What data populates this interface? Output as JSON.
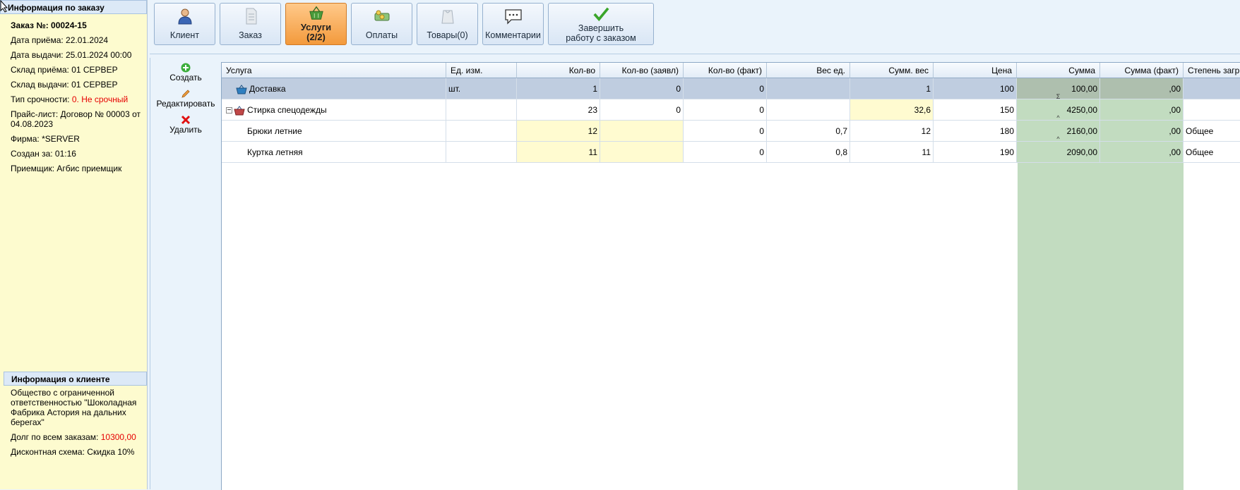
{
  "order_panel": {
    "title": "Информация по заказу",
    "order_number": "Заказ №: 00024-15",
    "received_date": "Дата приёма: 22.01.2024",
    "issue_date": "Дата выдачи: 25.01.2024 00:00",
    "receive_warehouse": "Склад приёма: 01 СЕРВЕР",
    "issue_warehouse": "Склад выдачи: 01 СЕРВЕР",
    "urgency_label": "Тип срочности:",
    "urgency_value": "0. Не срочный",
    "price_list": "Прайс-лист: Договор № 00003 от 04.08.2023",
    "firm": "Фирма: *SERVER",
    "created_for": "Создан за: 01:16",
    "receiver": "Приемщик: Агбис приемщик"
  },
  "client_panel": {
    "title": "Информация о клиенте",
    "name": "Общество с ограниченной ответственностью \"Шоколадная Фабрика Астория на дальних берегах\"",
    "debt_label": "Долг по всем заказам:",
    "debt_value": "10300,00",
    "discount": "Дисконтная схема: Скидка 10%"
  },
  "toolbar": {
    "client": "Клиент",
    "order": "Заказ",
    "services_line1": "Услуги",
    "services_line2": "(2/2)",
    "payments": "Оплаты",
    "goods": "Товары(0)",
    "comments": "Комментарии",
    "finish_line1": "Завершить",
    "finish_line2": "работу с заказом"
  },
  "actions": {
    "create": "Создать",
    "edit": "Редактировать",
    "delete": "Удалить"
  },
  "grid": {
    "columns": [
      "Услуга",
      "Ед. изм.",
      "Кол-во",
      "Кол-во (заявл)",
      "Кол-во (факт)",
      "Вес ед.",
      "Сумм. вес",
      "Цена",
      "Сумма",
      "Сумма (факт)",
      "Степень загр"
    ],
    "rows": [
      {
        "service": "Доставка",
        "unit": "шт.",
        "qty": "1",
        "qty_declared": "0",
        "qty_fact": "0",
        "unit_weight": "",
        "total_weight": "1",
        "price": "100",
        "sum": "100,00",
        "sum_fact": ",00",
        "degree": ""
      },
      {
        "service": "Стирка спецодежды",
        "unit": "",
        "qty": "23",
        "qty_declared": "0",
        "qty_fact": "0",
        "unit_weight": "",
        "total_weight": "32,6",
        "price": "150",
        "sum": "4250,00",
        "sum_fact": ",00",
        "degree": ""
      },
      {
        "service": "Брюки летние",
        "unit": "",
        "qty": "12",
        "qty_declared": "",
        "qty_fact": "0",
        "unit_weight": "0,7",
        "total_weight": "12",
        "price": "180",
        "sum": "2160,00",
        "sum_fact": ",00",
        "degree": "Общее"
      },
      {
        "service": "Куртка летняя",
        "unit": "",
        "qty": "11",
        "qty_declared": "",
        "qty_fact": "0",
        "unit_weight": "0,8",
        "total_weight": "11",
        "price": "190",
        "sum": "2090,00",
        "sum_fact": ",00",
        "degree": "Общее"
      }
    ]
  }
}
